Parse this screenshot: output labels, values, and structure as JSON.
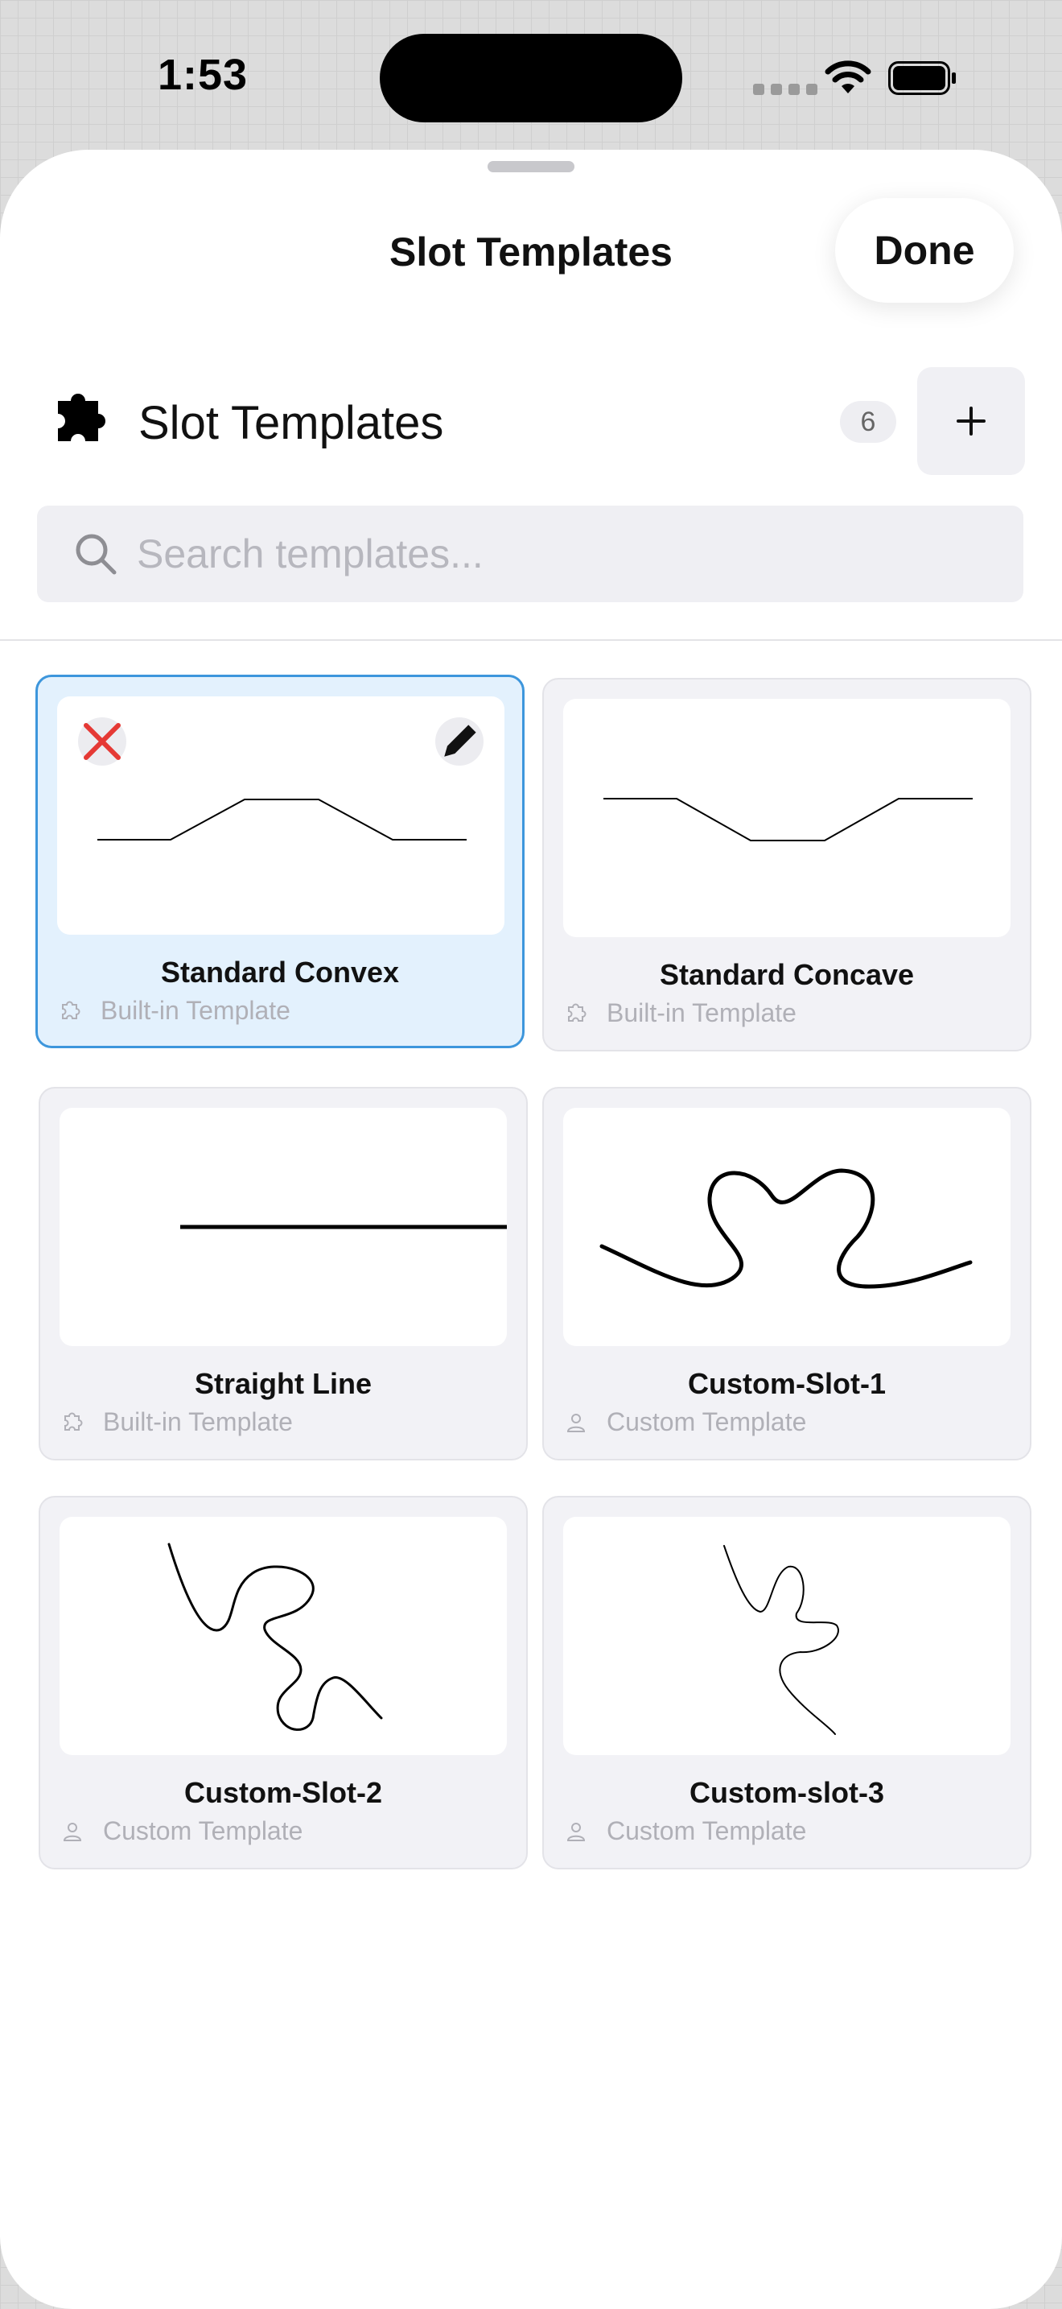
{
  "status_bar": {
    "time": "1:53"
  },
  "nav": {
    "title": "Slot Templates",
    "done_label": "Done"
  },
  "section": {
    "title": "Slot Templates",
    "count": "6",
    "add_label": "+"
  },
  "search": {
    "placeholder": "Search templates...",
    "value": ""
  },
  "colors": {
    "accent": "#3d96dc",
    "selected_bg": "#e3f1fd",
    "delete_red": "#e53935",
    "card_bg": "#f2f2f6"
  },
  "templates": [
    {
      "name": "Standard Convex",
      "type": "Built-in Template",
      "icon": "puzzle-icon",
      "selected": true
    },
    {
      "name": "Standard Concave",
      "type": "Built-in Template",
      "icon": "puzzle-icon",
      "selected": false
    },
    {
      "name": "Straight Line",
      "type": "Built-in Template",
      "icon": "puzzle-icon",
      "selected": false
    },
    {
      "name": "Custom-Slot-1",
      "type": "Custom Template",
      "icon": "person-icon",
      "selected": false
    },
    {
      "name": "Custom-Slot-2",
      "type": "Custom Template",
      "icon": "person-icon",
      "selected": false
    },
    {
      "name": "Custom-slot-3",
      "type": "Custom Template",
      "icon": "person-icon",
      "selected": false
    }
  ]
}
